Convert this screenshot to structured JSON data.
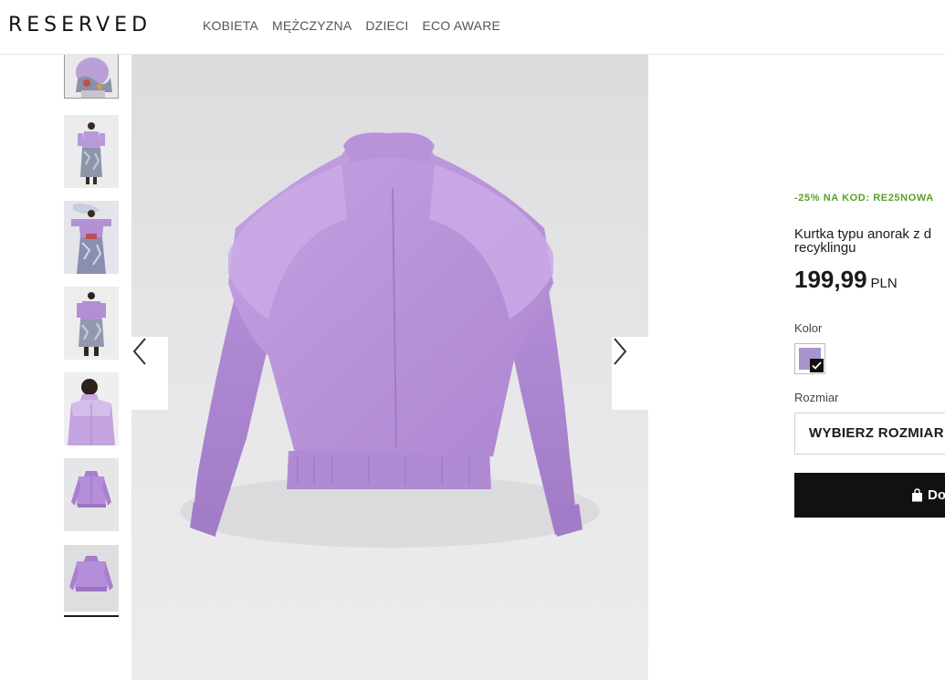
{
  "brand": {
    "logo": "RESERVED"
  },
  "nav": {
    "items": [
      {
        "label": "KOBIETA"
      },
      {
        "label": "MĘŻCZYZNA"
      },
      {
        "label": "DZIECI"
      },
      {
        "label": "ECO AWARE"
      }
    ]
  },
  "gallery": {
    "thumbnails": [
      {
        "icon": "jacket-on-model-icon"
      },
      {
        "icon": "model-full-body-icon"
      },
      {
        "icon": "model-full-body-icon"
      },
      {
        "icon": "model-full-body-icon"
      },
      {
        "icon": "model-upper-body-icon"
      },
      {
        "icon": "jacket-front-icon"
      },
      {
        "icon": "jacket-back-icon"
      }
    ],
    "active_index": 6,
    "main_image": {
      "icon": "jacket-back-photo"
    },
    "prev_icon": "chevron-left-icon",
    "next_icon": "chevron-right-icon"
  },
  "product": {
    "promo": "-25% NA KOD: RE25NOWA",
    "title": "Kurtka typu anorak z d recyklingu",
    "price": "199,99",
    "currency": "PLN",
    "color_label": "Kolor",
    "selected_color": "#a894cc",
    "size_label": "Rozmiar",
    "size_placeholder": "WYBIERZ ROZMIAR",
    "add_to_cart": "Do",
    "cart_icon": "shopping-bag-icon"
  },
  "colors": {
    "promo_green": "#5aa02c",
    "jacket_lavender": "#b894d6",
    "button_black": "#111111"
  }
}
